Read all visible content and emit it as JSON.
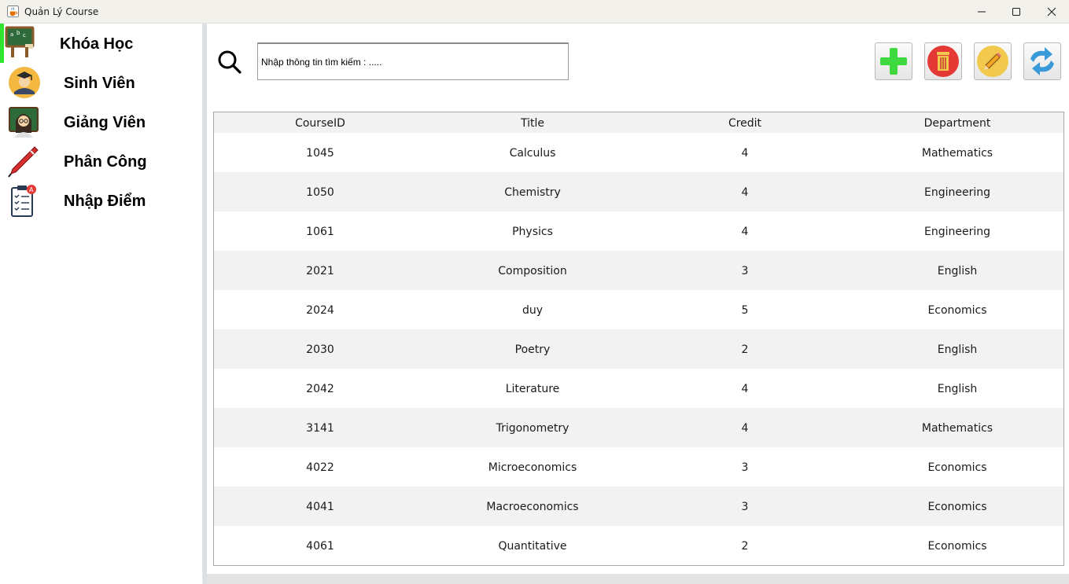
{
  "window": {
    "title": "Quản Lý Course",
    "icon": "java-cup-icon"
  },
  "sidebar": {
    "items": [
      {
        "label": "Khóa Học",
        "icon": "chalkboard-icon",
        "active": true
      },
      {
        "label": "Sinh Viên",
        "icon": "graduate-student-icon",
        "active": false
      },
      {
        "label": "Giảng Viên",
        "icon": "teacher-icon",
        "active": false
      },
      {
        "label": "Phân Công",
        "icon": "pen-icon",
        "active": false
      },
      {
        "label": "Nhập Điểm",
        "icon": "grade-checklist-icon",
        "active": false
      }
    ],
    "active_color": "#2ee52e"
  },
  "search": {
    "placeholder": "Nhập thông tin tìm kiếm : .....",
    "value": ""
  },
  "toolbar": {
    "buttons": [
      {
        "name": "add",
        "icon": "plus-icon",
        "color": "#3fd83f"
      },
      {
        "name": "delete",
        "icon": "trash-icon",
        "color": "#e53935"
      },
      {
        "name": "edit",
        "icon": "pencil-icon",
        "color": "#f2c94c"
      },
      {
        "name": "refresh",
        "icon": "refresh-icon",
        "color": "#3a9ad9"
      }
    ]
  },
  "table": {
    "columns": [
      "CourseID",
      "Title",
      "Credit",
      "Department"
    ],
    "rows": [
      [
        "1045",
        "Calculus",
        "4",
        "Mathematics"
      ],
      [
        "1050",
        "Chemistry",
        "4",
        "Engineering"
      ],
      [
        "1061",
        "Physics",
        "4",
        "Engineering"
      ],
      [
        "2021",
        "Composition",
        "3",
        "English"
      ],
      [
        "2024",
        "duy",
        "5",
        "Economics"
      ],
      [
        "2030",
        "Poetry",
        "2",
        "English"
      ],
      [
        "2042",
        "Literature",
        "4",
        "English"
      ],
      [
        "3141",
        "Trigonometry",
        "4",
        "Mathematics"
      ],
      [
        "4022",
        "Microeconomics",
        "3",
        "Economics"
      ],
      [
        "4041",
        "Macroeconomics",
        "3",
        "Economics"
      ],
      [
        "4061",
        "Quantitative",
        "2",
        "Economics"
      ]
    ]
  }
}
